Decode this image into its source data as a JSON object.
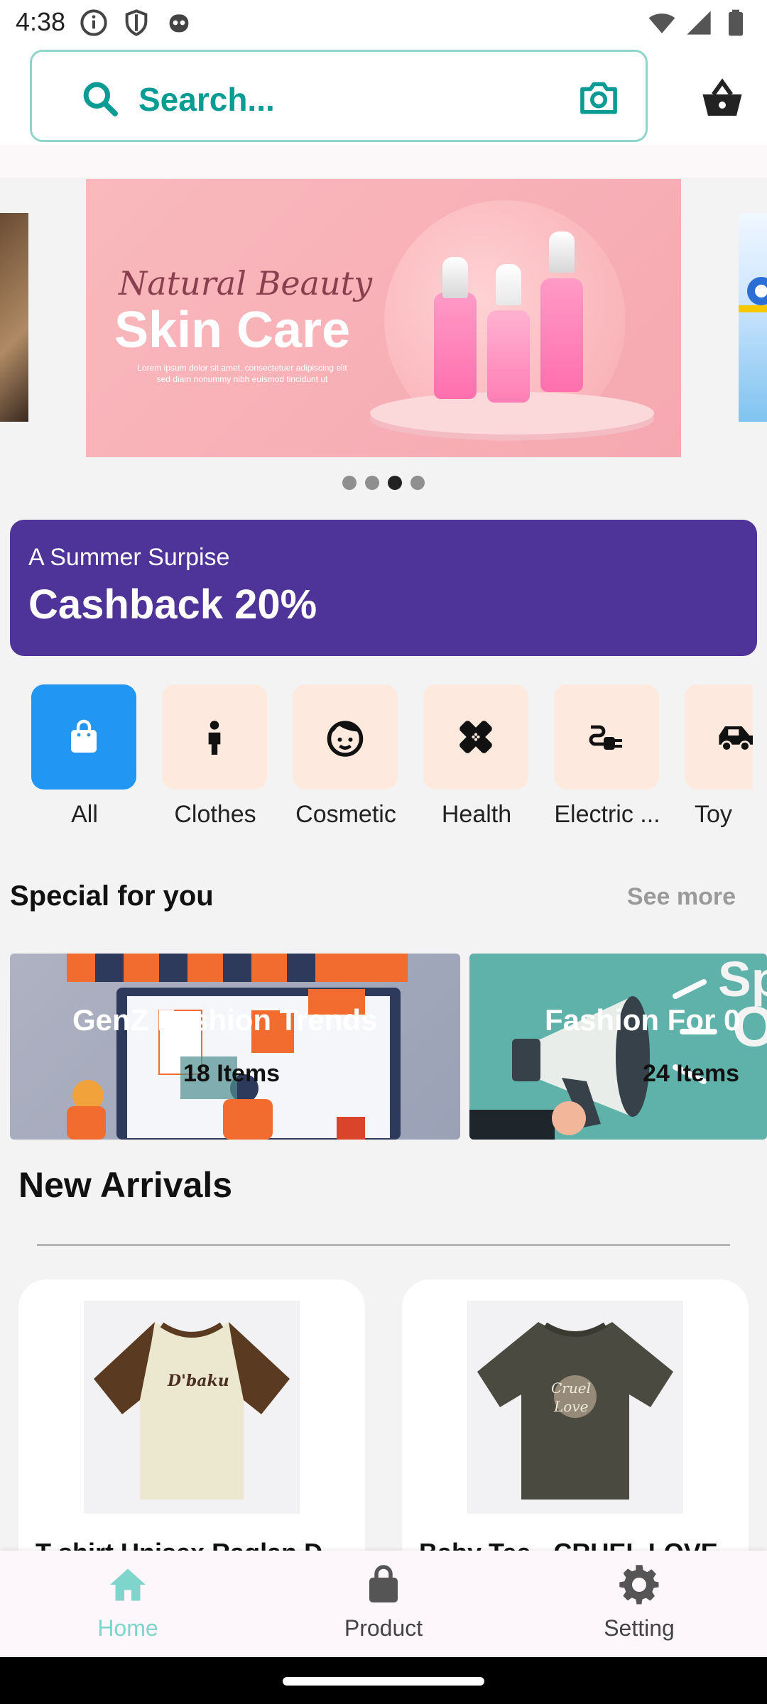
{
  "status_bar": {
    "time": "4:38"
  },
  "search": {
    "placeholder": "Search..."
  },
  "banner": {
    "script_line": "Natural Beauty",
    "title": "Skin Care",
    "subtitle": "Lorem ipsum dolor sit amet, consectetuer adipiscing elit sed diam nonummy nibh euismod tincidunt ut",
    "dots": 4,
    "active_dot": 2
  },
  "cashback": {
    "subtitle": "A Summer Surpise",
    "title": "Cashback 20%"
  },
  "categories": [
    {
      "label": "All",
      "icon": "shopping-bag-icon",
      "active": true
    },
    {
      "label": "Clothes",
      "icon": "person-icon",
      "active": false
    },
    {
      "label": "Cosmetic",
      "icon": "face-icon",
      "active": false
    },
    {
      "label": "Health",
      "icon": "bandage-icon",
      "active": false
    },
    {
      "label": "Electric ...",
      "icon": "plug-icon",
      "active": false
    },
    {
      "label": "Toy",
      "icon": "toy-car-icon",
      "active": false
    }
  ],
  "special": {
    "title": "Special for you",
    "see_more": "See more",
    "promos": [
      {
        "title": "GenZ Fashion Trends",
        "count": "18 Items"
      },
      {
        "title": "Fashion For 0",
        "count": "24 Items"
      }
    ]
  },
  "arrivals": {
    "title": "New Arrivals",
    "products": [
      {
        "name": "T-shirt Unisex Raglan D..."
      },
      {
        "name": "Baby Tee - CRUEL LOVE..."
      }
    ]
  },
  "bottom_nav": [
    {
      "label": "Home",
      "icon": "home-icon",
      "active": true
    },
    {
      "label": "Product",
      "icon": "shopping-bag-icon",
      "active": false
    },
    {
      "label": "Setting",
      "icon": "gear-icon",
      "active": false
    }
  ],
  "colors": {
    "accent": "#0a9b94",
    "cashback_bg": "#4e3398",
    "category_active": "#2196f3",
    "category_bg": "#fde9dd",
    "nav_active": "#7fd4cc"
  }
}
